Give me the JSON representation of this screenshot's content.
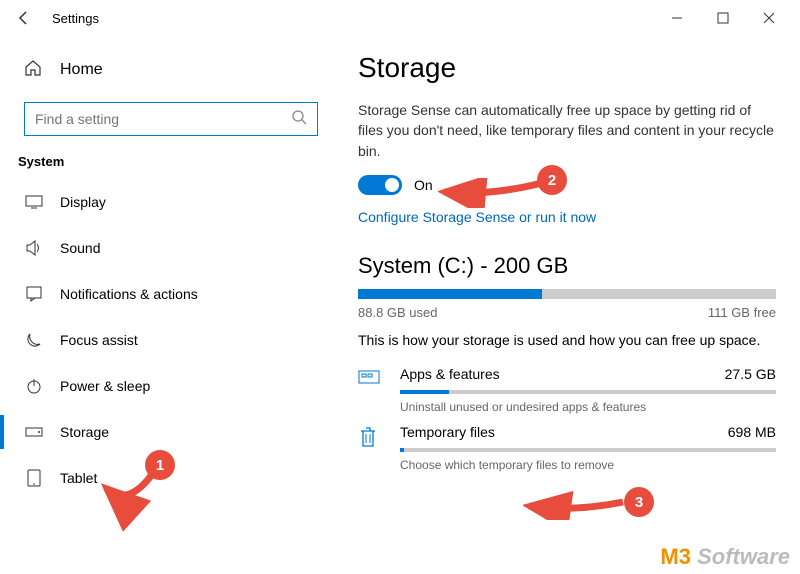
{
  "titlebar": {
    "title": "Settings"
  },
  "sidebar": {
    "home_label": "Home",
    "search_placeholder": "Find a setting",
    "section_label": "System",
    "items": [
      {
        "label": "Display"
      },
      {
        "label": "Sound"
      },
      {
        "label": "Notifications & actions"
      },
      {
        "label": "Focus assist"
      },
      {
        "label": "Power & sleep"
      },
      {
        "label": "Storage"
      },
      {
        "label": "Tablet"
      }
    ]
  },
  "main": {
    "title": "Storage",
    "description": "Storage Sense can automatically free up space by getting rid of files you don't need, like temporary files and content in your recycle bin.",
    "toggle_state": "On",
    "configure_link": "Configure Storage Sense or run it now",
    "drive": {
      "heading": "System (C:) - 200 GB",
      "used_label": "88.8 GB used",
      "free_label": "111 GB free",
      "used_percent": 44
    },
    "usage_text": "This is how your storage is used and how you can free up space.",
    "categories": [
      {
        "name": "Apps & features",
        "size": "27.5 GB",
        "sub": "Uninstall unused or undesired apps & features",
        "percent": 13
      },
      {
        "name": "Temporary files",
        "size": "698 MB",
        "sub": "Choose which temporary files to remove",
        "percent": 1
      }
    ]
  },
  "annotations": {
    "b1": "1",
    "b2": "2",
    "b3": "3"
  },
  "watermark": {
    "prefix": "M3",
    "suffix": " Software"
  }
}
